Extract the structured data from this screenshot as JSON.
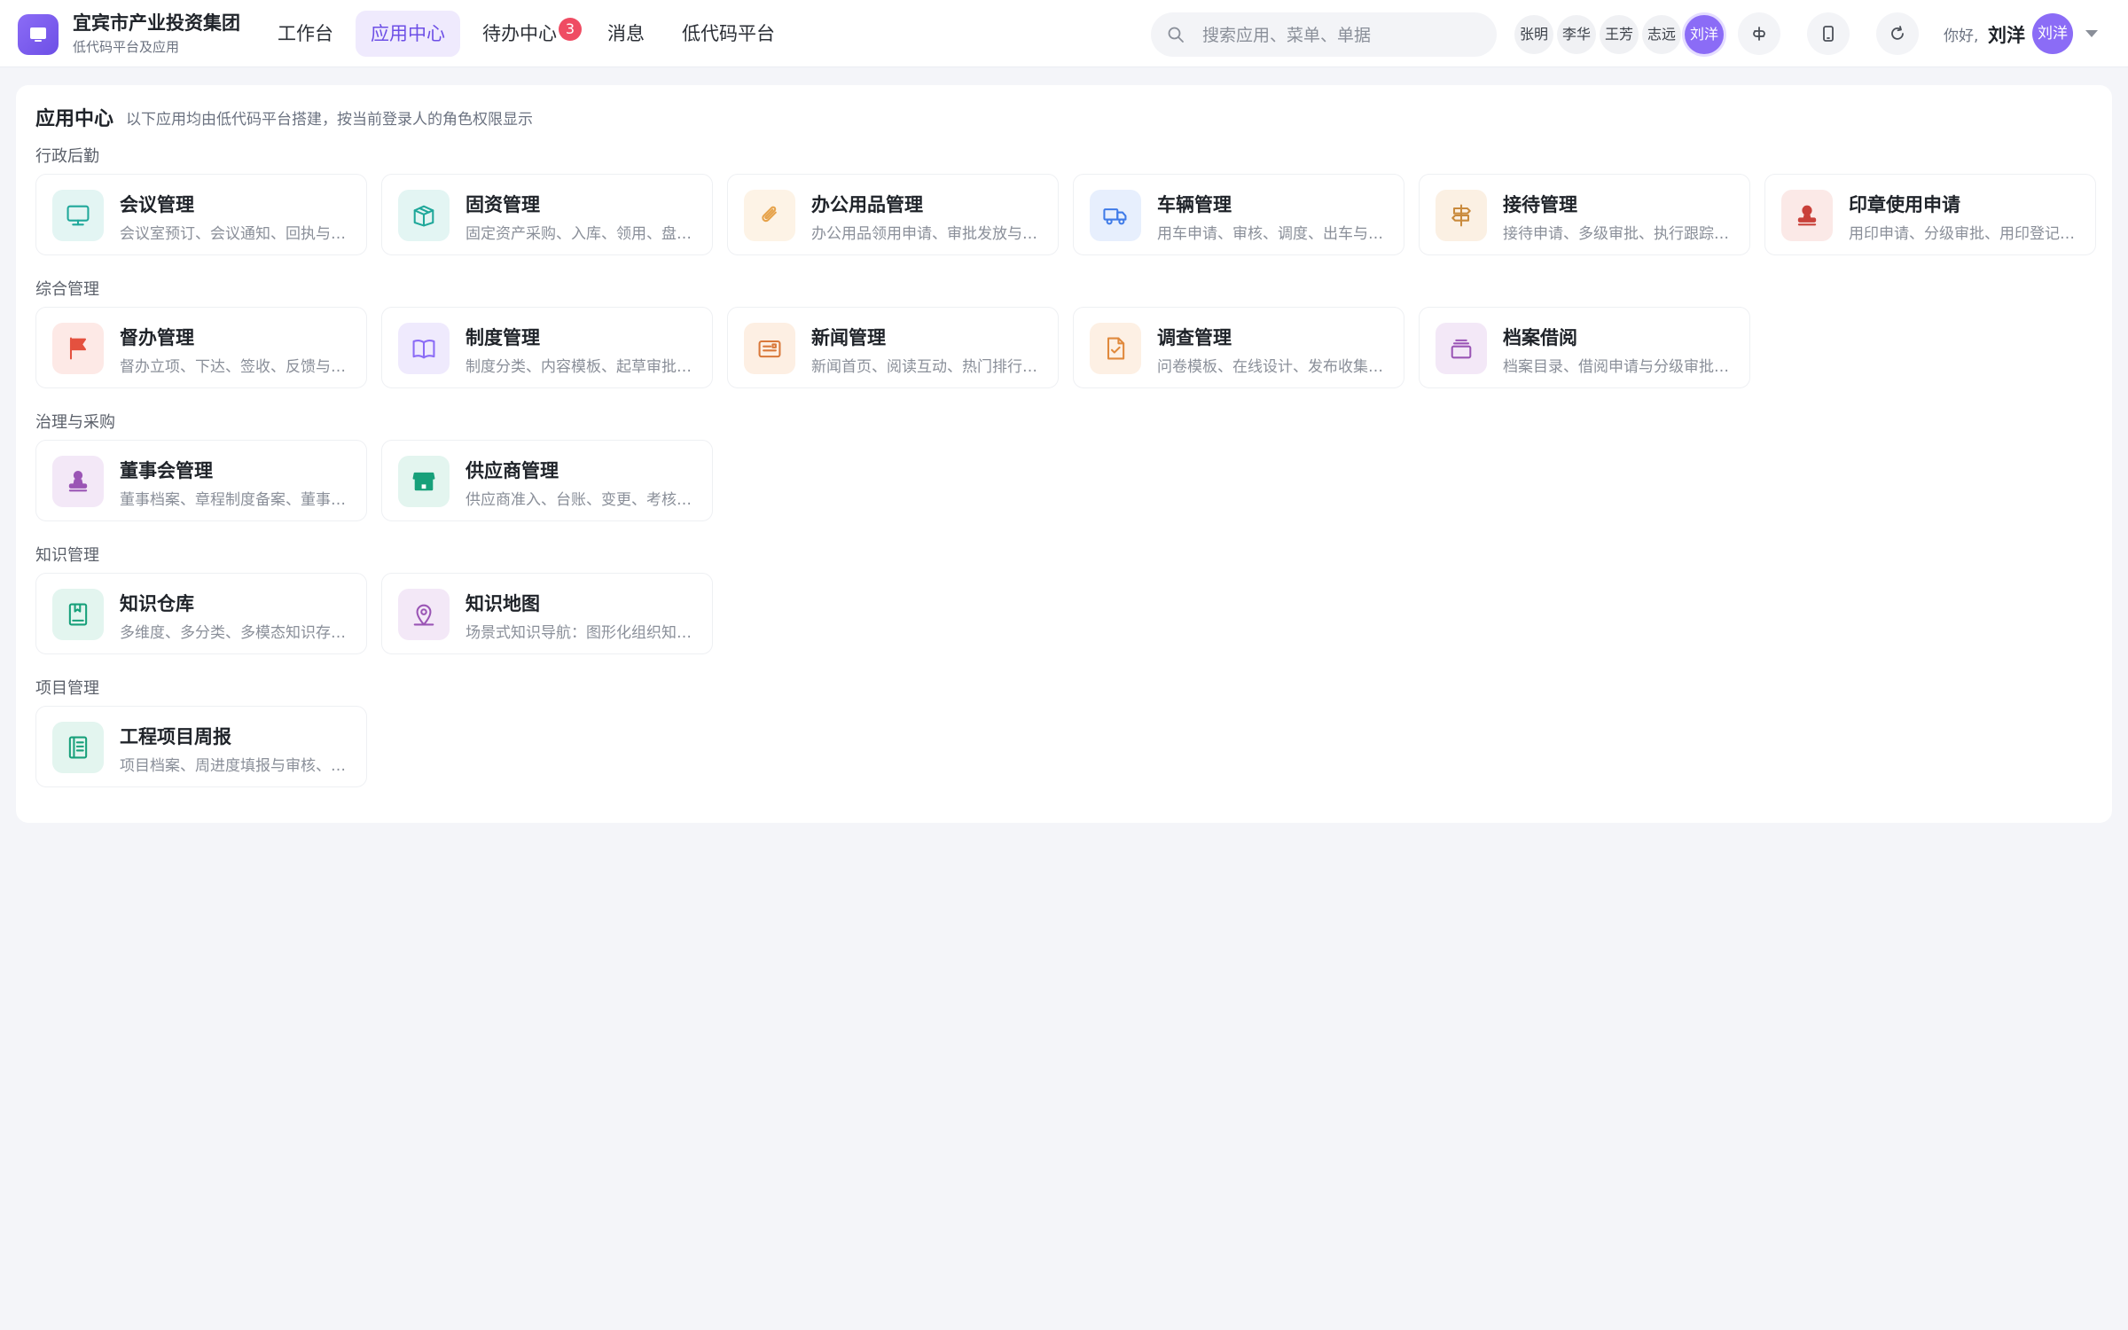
{
  "brand": {
    "name": "宜宾市产业投资集团",
    "subtitle": "低代码平台及应用"
  },
  "nav": [
    {
      "label": "工作台"
    },
    {
      "label": "应用中心",
      "active": true
    },
    {
      "label": "待办中心",
      "badge": "3"
    },
    {
      "label": "消息"
    },
    {
      "label": "低代码平台"
    }
  ],
  "search": {
    "placeholder": "搜索应用、菜单、单据"
  },
  "users": [
    "张明",
    "李华",
    "王芳",
    "志远",
    "刘洋"
  ],
  "current_user": {
    "greeting": "你好,",
    "name": "刘洋",
    "avatar_text": "刘洋"
  },
  "page": {
    "title": "应用中心",
    "description": "以下应用均由低代码平台搭建，按当前登录人的角色权限显示"
  },
  "sections": [
    {
      "title": "行政后勤",
      "apps": [
        {
          "title": "会议管理",
          "desc": "会议室预订、会议通知、回执与会议纪要",
          "icon": "monitor-icon",
          "bg": "#e3f5f3",
          "fg": "#1fa89a"
        },
        {
          "title": "固资管理",
          "desc": "固定资产采购、入库、领用、盘点与报废",
          "icon": "box-icon",
          "bg": "#e3f5f3",
          "fg": "#1fa89a"
        },
        {
          "title": "办公用品管理",
          "desc": "办公用品领用申请、审批发放与库存管理",
          "icon": "paperclip-icon",
          "bg": "#fdf3e6",
          "fg": "#e6a24a"
        },
        {
          "title": "车辆管理",
          "desc": "用车申请、审核、调度、出车与费用登记",
          "icon": "truck-icon",
          "bg": "#e7effd",
          "fg": "#3f7be8"
        },
        {
          "title": "接待管理",
          "desc": "接待申请、多级审批、执行跟踪与费用结算",
          "icon": "signpost-icon",
          "bg": "#fbf0e3",
          "fg": "#c98a3c"
        },
        {
          "title": "印章使用申请",
          "desc": "用印申请、分级审批、用印登记与归档",
          "icon": "stamp-icon",
          "bg": "#fbe9e7",
          "fg": "#c9413a"
        }
      ]
    },
    {
      "title": "综合管理",
      "apps": [
        {
          "title": "督办管理",
          "desc": "督办立项、下达、签收、反馈与办结评价",
          "icon": "flag-icon",
          "bg": "#fde9e6",
          "fg": "#e4513f"
        },
        {
          "title": "制度管理",
          "desc": "制度分类、内容模板、起草审批与发布",
          "icon": "book-open-icon",
          "bg": "#efeafd",
          "fg": "#8b6cf6"
        },
        {
          "title": "新闻管理",
          "desc": "新闻首页、阅读互动、热门排行与发布审核",
          "icon": "newspaper-icon",
          "bg": "#fdefe3",
          "fg": "#d9783a"
        },
        {
          "title": "调查管理",
          "desc": "问卷模板、在线设计、发布收集与统计分析",
          "icon": "file-check-icon",
          "bg": "#fdf0e4",
          "fg": "#e0893c"
        },
        {
          "title": "档案借阅",
          "desc": "档案目录、借阅申请与分级审批、归还登记",
          "icon": "layers-icon",
          "bg": "#f3e8f7",
          "fg": "#9a55b5"
        }
      ]
    },
    {
      "title": "治理与采购",
      "apps": [
        {
          "title": "董事会管理",
          "desc": "董事档案、章程制度备案、董事会议管理",
          "icon": "person-stamp-icon",
          "bg": "#f3e8f7",
          "fg": "#9a55b5"
        },
        {
          "title": "供应商管理",
          "desc": "供应商准入、台账、变更、考核与黑名单",
          "icon": "store-icon",
          "bg": "#e3f5ef",
          "fg": "#17a07a"
        }
      ]
    },
    {
      "title": "知识管理",
      "apps": [
        {
          "title": "知识仓库",
          "desc": "多维度、多分类、多模态知识存储与检索",
          "icon": "bookmark-book-icon",
          "bg": "#e3f5ef",
          "fg": "#17a07a"
        },
        {
          "title": "知识地图",
          "desc": "场景式知识导航：图形化组织知识与关联",
          "icon": "map-pin-icon",
          "bg": "#f3e8f7",
          "fg": "#9a55b5"
        }
      ]
    },
    {
      "title": "项目管理",
      "apps": [
        {
          "title": "工程项目周报",
          "desc": "项目档案、周进度填报与审核、汇总分析",
          "icon": "notebook-icon",
          "bg": "#e3f5ef",
          "fg": "#17a07a"
        }
      ]
    }
  ]
}
